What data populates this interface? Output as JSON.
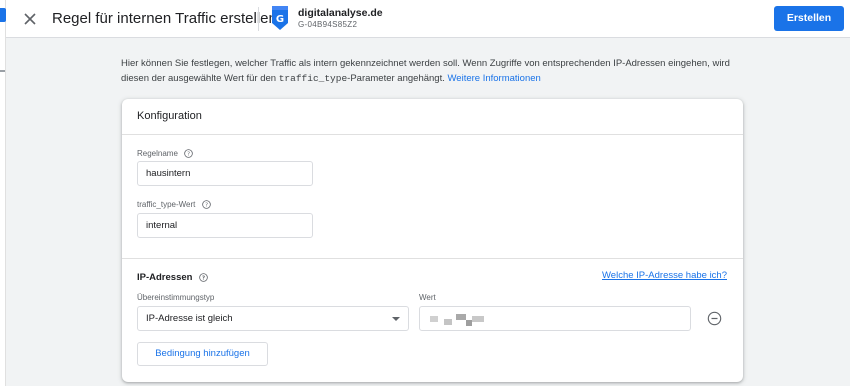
{
  "header": {
    "title": "Regel für internen Traffic erstellen",
    "property_name": "digitalanalyse.de",
    "property_id": "G-04B94S85Z2",
    "create_label": "Erstellen",
    "close_icon": "close-icon",
    "property_icon": "ga-property-icon"
  },
  "intro": {
    "text_before": "Hier können Sie festlegen, welcher Traffic als intern gekennzeichnet werden soll. Wenn Zugriffe von entsprechenden IP-Adressen eingehen, wird diesen der ausgewählte Wert für den ",
    "param_code": "traffic_type",
    "text_after": "-Parameter angehängt. ",
    "link_label": "Weitere Informationen"
  },
  "card": {
    "title": "Konfiguration",
    "rule_name": {
      "label": "Regelname",
      "value": "hausintern"
    },
    "traffic_type": {
      "label": "traffic_type-Wert",
      "value": "internal"
    },
    "ip_section": {
      "title": "IP-Adressen",
      "link_label": "Welche IP-Adresse habe ich?",
      "match_type_label": "Übereinstimmungstyp",
      "match_type_value": "IP-Adresse ist gleich",
      "value_label": "Wert",
      "value_redacted": true,
      "add_condition_label": "Bedingung hinzufügen"
    }
  },
  "colors": {
    "accent": "#1a73e8",
    "background": "#f1f3f4",
    "border": "#dadce0"
  }
}
